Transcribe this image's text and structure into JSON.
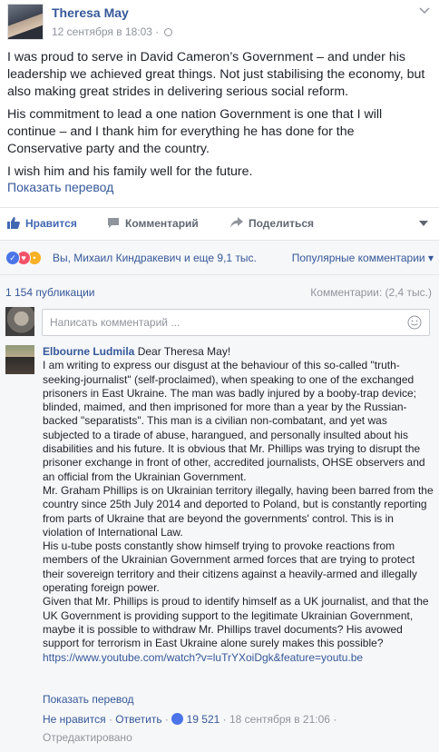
{
  "post": {
    "author": "Theresa May",
    "timestamp": "12 сентября в 18:03 ·",
    "paragraphs": [
      "I was proud to serve in David Cameron’s Government – and under his leadership we achieved great things. Not just stabilising the economy, but also making great strides in delivering serious social reform.",
      "His commitment to lead a one nation Government is one that I will continue – and I thank him for everything he has done for the Conservative party and the country.",
      "I wish him and his family well for the future."
    ],
    "translate_label": "Показать перевод"
  },
  "actions": {
    "like": "Нравится",
    "comment": "Комментарий",
    "share": "Поделиться"
  },
  "reactions": {
    "summary": "Вы, Михаил Киндракевич и еще 9,1 тыс.",
    "popular": "Популярные комментарии"
  },
  "counts": {
    "shares": "1 154 публикации",
    "comments": "Комментарии: (2,4 тыс.)"
  },
  "compose": {
    "placeholder": "Написать комментарий ..."
  },
  "comment": {
    "author": "Elbourne Ludmila",
    "lines": [
      "Dear Theresa May!",
      "I am writing to express our disgust at the behaviour of this so-called \"truth-seeking-journalist\" (self-proclaimed), when speaking to one of the exchanged prisoners in East Ukraine. The man was badly injured by a booby-trap device; blinded, maimed, and then imprisoned for more than a year by the Russian-backed \"separatists\". This man is a civilian non-combatant, and yet was subjected to a tirade of abuse, harangued, and personally insulted about his disabilities and his future. It is obvious that Mr. Phillips was trying to disrupt the prisoner exchange in front of other, accredited journalists, OHSE observers and an official from the Ukrainian Government.",
      "Mr. Graham Phillips is on Ukrainian territory illegally, having been barred from the country since 25th July 2014 and deported to Poland, but is constantly reporting from parts of Ukraine that are beyond the governments' control. This is in violation of International Law.",
      "His u-tube posts constantly show himself trying to provoke reactions from members of the Ukrainian Government armed forces that are trying to protect their sovereign territory and their citizens against a heavily-armed and illegally operating foreign power.",
      "Given that Mr. Phillips is proud to identify himself as a UK journalist, and that the UK Government is providing support to the legitimate Ukrainian Government, maybe it is possible to withdraw Mr. Phillips travel documents? His avowed support for terrorism in East Ukraine alone surely makes this possible?"
    ],
    "link": "https://www.youtube.com/watch?v=luTrYXoiDgk&feature=youtu.be",
    "translate_label": "Показать перевод",
    "unlike": "Не нравится",
    "reply": "Ответить",
    "like_count": "19 521",
    "date": "18 сентября в 21:06",
    "edited": "Отредактировано"
  },
  "colors": {
    "link": "#365899",
    "like_blue": "#4267b2",
    "muted": "#90949c",
    "panel_bg": "#f6f7f9"
  },
  "icons": [
    "globe-icon",
    "chevron-down-icon",
    "thumbs-up-icon",
    "comment-icon",
    "share-icon",
    "like-reaction-icon",
    "love-reaction-icon",
    "haha-reaction-icon",
    "smiley-icon"
  ]
}
